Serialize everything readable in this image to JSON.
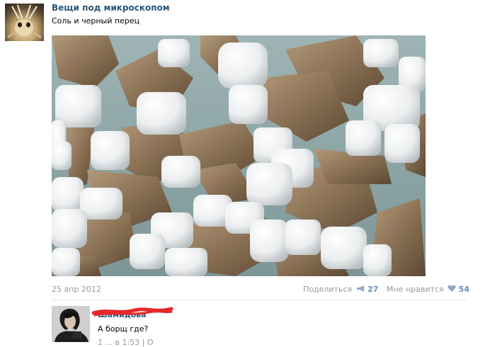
{
  "post": {
    "author": "Вещи под микроскопом",
    "text": "Соль и черный перец",
    "date": "25 апр 2012",
    "share_label": "Поделиться",
    "share_count": "27",
    "like_label": "Мне нравится",
    "like_count": "54"
  },
  "comment": {
    "author_name": "Шамидова",
    "text": "А борщ где?",
    "meta": "1 ... в 1:53 | О"
  },
  "colors": {
    "link": "#2b587a",
    "muted": "#999999",
    "accent": "#6b8db5",
    "scribble": "#e8262a"
  },
  "icons": {
    "share": "megaphone-icon",
    "like": "heart-icon"
  }
}
